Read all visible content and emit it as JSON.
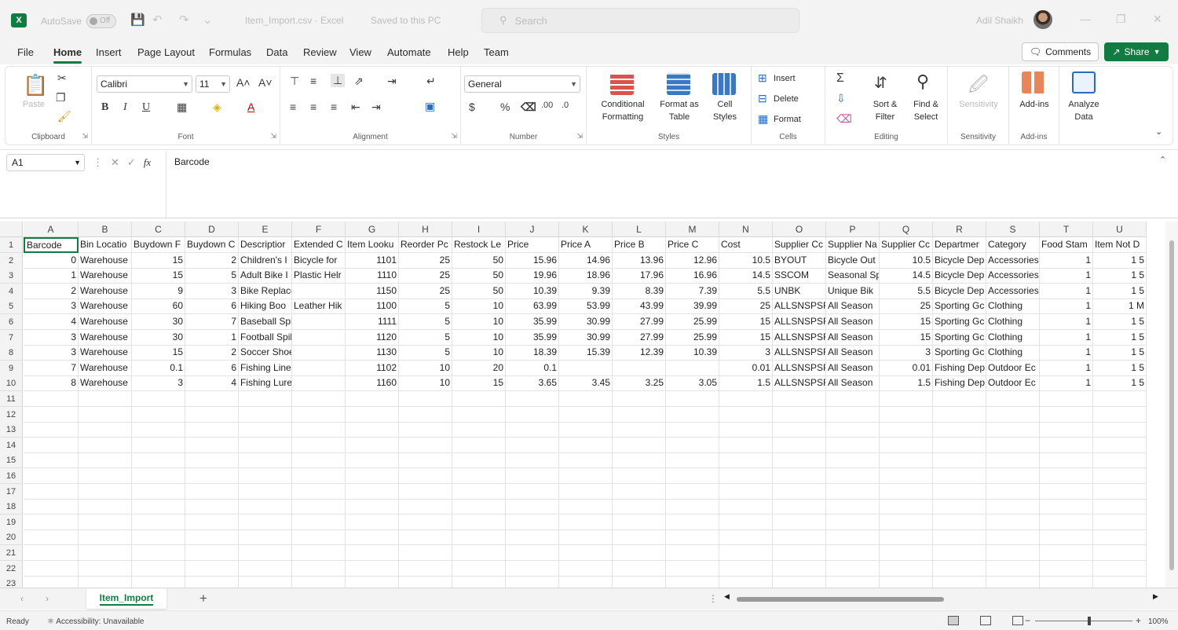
{
  "titlebar": {
    "autosave_label": "AutoSave",
    "autosave_state": "Off",
    "document_title": "Item_Import.csv · Excel",
    "saved_state": "Saved to this PC",
    "search_placeholder": "Search",
    "username": "Adil Shaikh"
  },
  "menu": {
    "tabs": [
      "File",
      "Home",
      "Insert",
      "Page Layout",
      "Formulas",
      "Data",
      "Review",
      "View",
      "Automate",
      "Help",
      "Team"
    ],
    "active_tab": "Home",
    "comments": "Comments",
    "share": "Share"
  },
  "ribbon": {
    "clipboard": {
      "label": "Clipboard",
      "paste": "Paste"
    },
    "font": {
      "label": "Font",
      "name": "Calibri",
      "size": "11"
    },
    "alignment": {
      "label": "Alignment"
    },
    "number": {
      "label": "Number",
      "format": "General"
    },
    "styles": {
      "label": "Styles",
      "conditional": "Conditional Formatting",
      "format_table": "Format as Table",
      "cell_styles": "Cell Styles"
    },
    "cells": {
      "label": "Cells",
      "insert": "Insert",
      "delete": "Delete",
      "format": "Format"
    },
    "editing": {
      "label": "Editing",
      "sort": "Sort & Filter",
      "find": "Find & Select"
    },
    "sensitivity": {
      "label": "Sensitivity",
      "button": "Sensitivity"
    },
    "addins": {
      "label": "Add-ins",
      "button": "Add-ins"
    },
    "analyze": {
      "button": "Analyze Data"
    }
  },
  "formula_bar": {
    "name_box": "A1",
    "content": "Barcode"
  },
  "sheet": {
    "columns": [
      "A",
      "B",
      "C",
      "D",
      "E",
      "F",
      "G",
      "H",
      "I",
      "J",
      "K",
      "L",
      "M",
      "N",
      "O",
      "P",
      "Q",
      "R",
      "S",
      "T",
      "U"
    ],
    "row_numbers": [
      "1",
      "2",
      "3",
      "4",
      "5",
      "6",
      "7",
      "8",
      "9",
      "10",
      "11",
      "12",
      "13",
      "14",
      "15",
      "16",
      "17",
      "18",
      "19",
      "20",
      "21",
      "22",
      "23"
    ],
    "rows": [
      [
        "Barcode",
        "Bin Locatio",
        "Buydown F",
        "Buydown C",
        "Descriptior",
        "Extended C",
        "Item Looku",
        "Reorder Pc",
        "Restock Le",
        "Price",
        "Price A",
        "Price B",
        "Price C",
        "Cost",
        "Supplier Cc",
        "Supplier Na",
        "Supplier Cc",
        "Departmer",
        "Category",
        "Food Stam",
        "Item Not D"
      ],
      [
        "0",
        "Warehouse",
        "15",
        "2",
        "Children's I",
        "Bicycle for",
        "1101",
        "25",
        "50",
        "15.96",
        "14.96",
        "13.96",
        "12.96",
        "10.5",
        "BYOUT",
        "Bicycle Out",
        "10.5",
        "Bicycle Dep",
        "Accessories",
        "1",
        "1 5"
      ],
      [
        "1",
        "Warehouse",
        "15",
        "5",
        "Adult Bike I",
        "Plastic Helr",
        "1110",
        "25",
        "50",
        "19.96",
        "18.96",
        "17.96",
        "16.96",
        "14.5",
        "SSCOM",
        "Seasonal Sp",
        "14.5",
        "Bicycle Dep",
        "Accessories",
        "1",
        "1 5"
      ],
      [
        "2",
        "Warehouse",
        "9",
        "3",
        "Bike Replacement Chai",
        "",
        "1150",
        "25",
        "50",
        "10.39",
        "9.39",
        "8.39",
        "7.39",
        "5.5",
        "UNBK",
        "Unique Bik",
        "5.5",
        "Bicycle Dep",
        "Accessories",
        "1",
        "1 5"
      ],
      [
        "3",
        "Warehouse",
        "60",
        "6",
        "Hiking Boo",
        "Leather Hik",
        "1100",
        "5",
        "10",
        "63.99",
        "53.99",
        "43.99",
        "39.99",
        "25",
        "ALLSNSPSF",
        "All Season",
        "25",
        "Sporting Gc",
        "Clothing",
        "1",
        "1 M"
      ],
      [
        "4",
        "Warehouse",
        "30",
        "7",
        "Baseball Spikes",
        "",
        "1111",
        "5",
        "10",
        "35.99",
        "30.99",
        "27.99",
        "25.99",
        "15",
        "ALLSNSPSF",
        "All Season",
        "15",
        "Sporting Gc",
        "Clothing",
        "1",
        "1 5"
      ],
      [
        "3",
        "Warehouse",
        "30",
        "1",
        "Football Spikes",
        "",
        "1120",
        "5",
        "10",
        "35.99",
        "30.99",
        "27.99",
        "25.99",
        "15",
        "ALLSNSPSF",
        "All Season",
        "15",
        "Sporting Gc",
        "Clothing",
        "1",
        "1 5"
      ],
      [
        "3",
        "Warehouse",
        "15",
        "2",
        "Soccer Shoes",
        "",
        "1130",
        "5",
        "10",
        "18.39",
        "15.39",
        "12.39",
        "10.39",
        "3",
        "ALLSNSPSF",
        "All Season",
        "3",
        "Sporting Gc",
        "Clothing",
        "1",
        "1 5"
      ],
      [
        "7",
        "Warehouse",
        "0.1",
        "6",
        "Fishing Line",
        "",
        "1102",
        "10",
        "20",
        "0.1",
        "",
        "",
        "",
        "0.01",
        "ALLSNSPSF",
        "All Season",
        "0.01",
        "Fishing Dep",
        "Outdoor Ec",
        "1",
        "1 5"
      ],
      [
        "8",
        "Warehouse",
        "3",
        "4",
        "Fishing Lure",
        "",
        "1160",
        "10",
        "15",
        "3.65",
        "3.45",
        "3.25",
        "3.05",
        "1.5",
        "ALLSNSPSF",
        "All Season",
        "1.5",
        "Fishing Dep",
        "Outdoor Ec",
        "1",
        "1 5"
      ]
    ],
    "numeric_columns": [
      0,
      2,
      3,
      6,
      7,
      8,
      9,
      10,
      11,
      12,
      13,
      16,
      19,
      20
    ],
    "sheet_tab": "Item_Import"
  },
  "statusbar": {
    "ready": "Ready",
    "accessibility": "Accessibility: Unavailable",
    "zoom": "100%"
  },
  "colors": {
    "accent": "#107c41"
  }
}
